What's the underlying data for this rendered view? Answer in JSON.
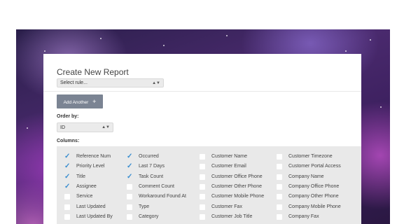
{
  "form": {
    "title": "Create New Report",
    "rule_select_value": "Select rule...",
    "add_button_label": "Add Another",
    "add_button_icon": "plus-icon",
    "order_label": "Order by:",
    "order_value": "ID",
    "columns_label": "Columns:"
  },
  "columns": [
    [
      {
        "label": "Reference Num",
        "checked": true
      },
      {
        "label": "Priority Level",
        "checked": true
      },
      {
        "label": "Title",
        "checked": true
      },
      {
        "label": "Assignee",
        "checked": true
      },
      {
        "label": "Service",
        "checked": false
      },
      {
        "label": "Last Updated",
        "checked": false
      },
      {
        "label": "Last Updated By",
        "checked": false
      }
    ],
    [
      {
        "label": "Occurred",
        "checked": true
      },
      {
        "label": "Last 7 Days",
        "checked": true
      },
      {
        "label": "Task Count",
        "checked": true
      },
      {
        "label": "Comment Count",
        "checked": false
      },
      {
        "label": "Workaround Found At",
        "checked": false
      },
      {
        "label": "Type",
        "checked": false
      },
      {
        "label": "Category",
        "checked": false
      }
    ],
    [
      {
        "label": "Customer Name",
        "checked": false
      },
      {
        "label": "Customer Email",
        "checked": false
      },
      {
        "label": "Customer Office Phone",
        "checked": false
      },
      {
        "label": "Customer Other Phone",
        "checked": false
      },
      {
        "label": "Customer Mobile Phone",
        "checked": false
      },
      {
        "label": "Customer Fax",
        "checked": false
      },
      {
        "label": "Customer Job Title",
        "checked": false
      }
    ],
    [
      {
        "label": "Customer Timezone",
        "checked": false
      },
      {
        "label": "Customer Portal Access",
        "checked": false
      },
      {
        "label": "Company Name",
        "checked": false
      },
      {
        "label": "Company Office Phone",
        "checked": false
      },
      {
        "label": "Company Other Phone",
        "checked": false
      },
      {
        "label": "Company Mobile Phone",
        "checked": false
      },
      {
        "label": "Company Fax",
        "checked": false
      }
    ]
  ],
  "colors": {
    "accent_check": "#3a8ed0",
    "button_bg": "#7b8493"
  }
}
